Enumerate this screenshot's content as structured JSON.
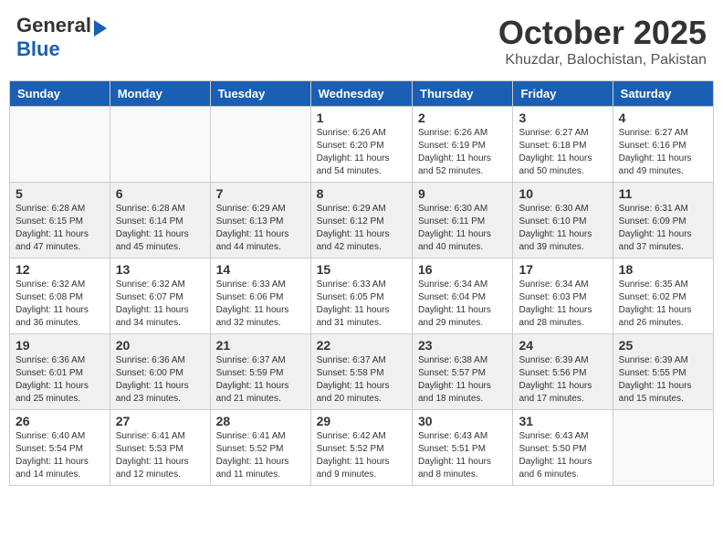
{
  "logo": {
    "general": "General",
    "blue": "Blue"
  },
  "header": {
    "month": "October 2025",
    "location": "Khuzdar, Balochistan, Pakistan"
  },
  "weekdays": [
    "Sunday",
    "Monday",
    "Tuesday",
    "Wednesday",
    "Thursday",
    "Friday",
    "Saturday"
  ],
  "weeks": [
    [
      {
        "day": "",
        "sunrise": "",
        "sunset": "",
        "daylight": ""
      },
      {
        "day": "",
        "sunrise": "",
        "sunset": "",
        "daylight": ""
      },
      {
        "day": "",
        "sunrise": "",
        "sunset": "",
        "daylight": ""
      },
      {
        "day": "1",
        "sunrise": "6:26 AM",
        "sunset": "6:20 PM",
        "daylight": "11 hours and 54 minutes."
      },
      {
        "day": "2",
        "sunrise": "6:26 AM",
        "sunset": "6:19 PM",
        "daylight": "11 hours and 52 minutes."
      },
      {
        "day": "3",
        "sunrise": "6:27 AM",
        "sunset": "6:18 PM",
        "daylight": "11 hours and 50 minutes."
      },
      {
        "day": "4",
        "sunrise": "6:27 AM",
        "sunset": "6:16 PM",
        "daylight": "11 hours and 49 minutes."
      }
    ],
    [
      {
        "day": "5",
        "sunrise": "6:28 AM",
        "sunset": "6:15 PM",
        "daylight": "11 hours and 47 minutes."
      },
      {
        "day": "6",
        "sunrise": "6:28 AM",
        "sunset": "6:14 PM",
        "daylight": "11 hours and 45 minutes."
      },
      {
        "day": "7",
        "sunrise": "6:29 AM",
        "sunset": "6:13 PM",
        "daylight": "11 hours and 44 minutes."
      },
      {
        "day": "8",
        "sunrise": "6:29 AM",
        "sunset": "6:12 PM",
        "daylight": "11 hours and 42 minutes."
      },
      {
        "day": "9",
        "sunrise": "6:30 AM",
        "sunset": "6:11 PM",
        "daylight": "11 hours and 40 minutes."
      },
      {
        "day": "10",
        "sunrise": "6:30 AM",
        "sunset": "6:10 PM",
        "daylight": "11 hours and 39 minutes."
      },
      {
        "day": "11",
        "sunrise": "6:31 AM",
        "sunset": "6:09 PM",
        "daylight": "11 hours and 37 minutes."
      }
    ],
    [
      {
        "day": "12",
        "sunrise": "6:32 AM",
        "sunset": "6:08 PM",
        "daylight": "11 hours and 36 minutes."
      },
      {
        "day": "13",
        "sunrise": "6:32 AM",
        "sunset": "6:07 PM",
        "daylight": "11 hours and 34 minutes."
      },
      {
        "day": "14",
        "sunrise": "6:33 AM",
        "sunset": "6:06 PM",
        "daylight": "11 hours and 32 minutes."
      },
      {
        "day": "15",
        "sunrise": "6:33 AM",
        "sunset": "6:05 PM",
        "daylight": "11 hours and 31 minutes."
      },
      {
        "day": "16",
        "sunrise": "6:34 AM",
        "sunset": "6:04 PM",
        "daylight": "11 hours and 29 minutes."
      },
      {
        "day": "17",
        "sunrise": "6:34 AM",
        "sunset": "6:03 PM",
        "daylight": "11 hours and 28 minutes."
      },
      {
        "day": "18",
        "sunrise": "6:35 AM",
        "sunset": "6:02 PM",
        "daylight": "11 hours and 26 minutes."
      }
    ],
    [
      {
        "day": "19",
        "sunrise": "6:36 AM",
        "sunset": "6:01 PM",
        "daylight": "11 hours and 25 minutes."
      },
      {
        "day": "20",
        "sunrise": "6:36 AM",
        "sunset": "6:00 PM",
        "daylight": "11 hours and 23 minutes."
      },
      {
        "day": "21",
        "sunrise": "6:37 AM",
        "sunset": "5:59 PM",
        "daylight": "11 hours and 21 minutes."
      },
      {
        "day": "22",
        "sunrise": "6:37 AM",
        "sunset": "5:58 PM",
        "daylight": "11 hours and 20 minutes."
      },
      {
        "day": "23",
        "sunrise": "6:38 AM",
        "sunset": "5:57 PM",
        "daylight": "11 hours and 18 minutes."
      },
      {
        "day": "24",
        "sunrise": "6:39 AM",
        "sunset": "5:56 PM",
        "daylight": "11 hours and 17 minutes."
      },
      {
        "day": "25",
        "sunrise": "6:39 AM",
        "sunset": "5:55 PM",
        "daylight": "11 hours and 15 minutes."
      }
    ],
    [
      {
        "day": "26",
        "sunrise": "6:40 AM",
        "sunset": "5:54 PM",
        "daylight": "11 hours and 14 minutes."
      },
      {
        "day": "27",
        "sunrise": "6:41 AM",
        "sunset": "5:53 PM",
        "daylight": "11 hours and 12 minutes."
      },
      {
        "day": "28",
        "sunrise": "6:41 AM",
        "sunset": "5:52 PM",
        "daylight": "11 hours and 11 minutes."
      },
      {
        "day": "29",
        "sunrise": "6:42 AM",
        "sunset": "5:52 PM",
        "daylight": "11 hours and 9 minutes."
      },
      {
        "day": "30",
        "sunrise": "6:43 AM",
        "sunset": "5:51 PM",
        "daylight": "11 hours and 8 minutes."
      },
      {
        "day": "31",
        "sunrise": "6:43 AM",
        "sunset": "5:50 PM",
        "daylight": "11 hours and 6 minutes."
      },
      {
        "day": "",
        "sunrise": "",
        "sunset": "",
        "daylight": ""
      }
    ]
  ]
}
